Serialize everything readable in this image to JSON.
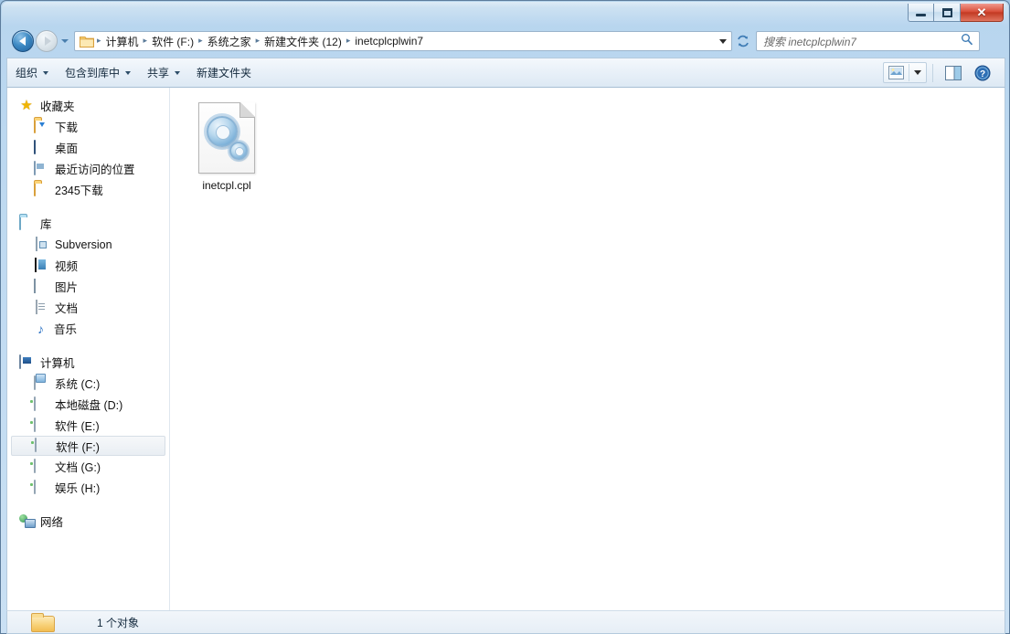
{
  "window": {
    "controls": {
      "minimize_label": "Minimize",
      "maximize_label": "Restore",
      "close_label": "✕"
    }
  },
  "addressbar": {
    "back_label": "后退",
    "forward_label": "前进",
    "history_label": "最近浏览的位置",
    "refresh_label": "刷新",
    "crumb_dropdown_label": "上一个位置",
    "breadcrumbs": [
      "计算机",
      "软件 (F:)",
      "系统之家",
      "新建文件夹 (12)",
      "inetcplcplwin7"
    ],
    "separator": "▸"
  },
  "search": {
    "placeholder": "搜索 inetcplcplwin7",
    "value": ""
  },
  "toolbar": {
    "items": [
      {
        "label": "组织",
        "has_chevron": true
      },
      {
        "label": "包含到库中",
        "has_chevron": true
      },
      {
        "label": "共享",
        "has_chevron": true
      },
      {
        "label": "新建文件夹",
        "has_chevron": false
      }
    ],
    "view_button_label": "更改您的视图",
    "preview_pane_label": "显示预览窗格",
    "help_label": "获取帮助"
  },
  "sidebar": {
    "groups": [
      {
        "root": {
          "label": "收藏夹",
          "icon": "star-icon"
        },
        "children": [
          {
            "label": "下载",
            "icon": "downloads-folder-icon"
          },
          {
            "label": "桌面",
            "icon": "desktop-icon"
          },
          {
            "label": "最近访问的位置",
            "icon": "recent-places-icon"
          },
          {
            "label": "2345下载",
            "icon": "folder-icon"
          }
        ]
      },
      {
        "root": {
          "label": "库",
          "icon": "library-icon"
        },
        "children": [
          {
            "label": "Subversion",
            "icon": "subversion-icon"
          },
          {
            "label": "视频",
            "icon": "video-icon"
          },
          {
            "label": "图片",
            "icon": "pictures-icon"
          },
          {
            "label": "文档",
            "icon": "documents-icon"
          },
          {
            "label": "音乐",
            "icon": "music-icon"
          }
        ]
      },
      {
        "root": {
          "label": "计算机",
          "icon": "computer-icon"
        },
        "children": [
          {
            "label": "系统 (C:)",
            "icon": "system-drive-icon",
            "selected": false
          },
          {
            "label": "本地磁盘 (D:)",
            "icon": "drive-icon",
            "selected": false
          },
          {
            "label": "软件 (E:)",
            "icon": "drive-icon",
            "selected": false
          },
          {
            "label": "软件 (F:)",
            "icon": "drive-icon",
            "selected": true
          },
          {
            "label": "文档 (G:)",
            "icon": "drive-icon",
            "selected": false
          },
          {
            "label": "娱乐 (H:)",
            "icon": "drive-icon",
            "selected": false
          }
        ]
      },
      {
        "root": {
          "label": "网络",
          "icon": "network-icon"
        },
        "children": []
      }
    ]
  },
  "content": {
    "files": [
      {
        "name": "inetcpl.cpl",
        "icon": "control-panel-file-icon"
      }
    ]
  },
  "statusbar": {
    "text": "1 个对象",
    "icon": "folder-icon"
  },
  "colors": {
    "accent": "#2b72c4",
    "close_button": "#c33a23",
    "glass": "#bcd9f0",
    "selection": "#e9eef3"
  }
}
